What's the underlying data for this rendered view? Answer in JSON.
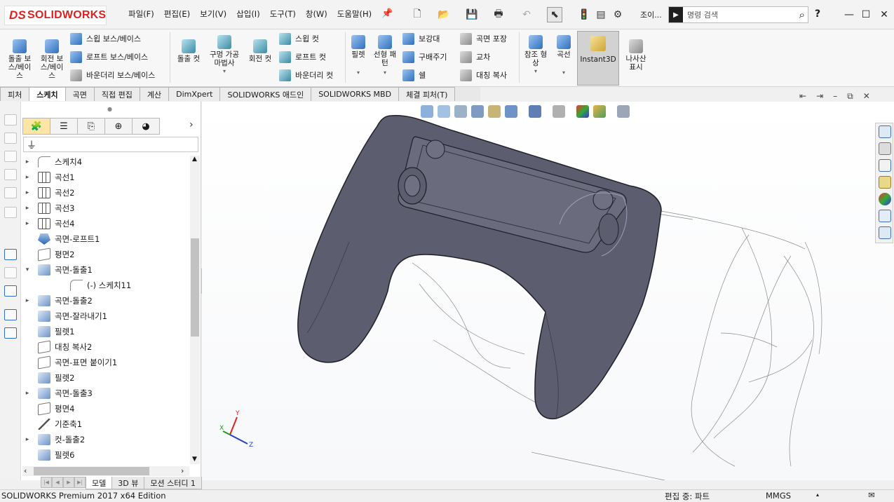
{
  "app": {
    "logo_text": "SOLIDWORKS",
    "menu": [
      "파일(F)",
      "편집(E)",
      "보기(V)",
      "삽입(I)",
      "도구(T)",
      "창(W)",
      "도움말(H)"
    ],
    "user_label": "조이...",
    "search_placeholder": "명령 검색",
    "help_label": "?"
  },
  "command_manager": {
    "large_buttons": [
      {
        "label": "돌출 보\n스/베이\n스",
        "icon": "extruded-boss-icon"
      },
      {
        "label": "회전 보\n스/베이\n스",
        "icon": "revolved-boss-icon"
      }
    ],
    "boss_group": [
      "스윕 보스/베이스",
      "로프트 보스/베이스",
      "바운더리 보스/베이스"
    ],
    "cut_large": [
      {
        "label": "돌출 컷",
        "icon": "extruded-cut-icon"
      },
      {
        "label": "구멍 가공\n마법사",
        "icon": "hole-wizard-icon"
      },
      {
        "label": "회전 컷",
        "icon": "revolved-cut-icon"
      }
    ],
    "cut_group": [
      "스윕 컷",
      "로프트 컷",
      "바운더리 컷"
    ],
    "feature_large": [
      {
        "label": "필렛",
        "icon": "fillet-icon"
      },
      {
        "label": "선형 패\n턴",
        "icon": "linear-pattern-icon"
      }
    ],
    "feature_group_a": [
      "보강대",
      "구배주기",
      "쉘"
    ],
    "feature_group_b": [
      "곡면 포장",
      "교차",
      "대칭 복사"
    ],
    "ref_large": [
      {
        "label": "참조 형\n상",
        "icon": "reference-geometry-icon"
      },
      {
        "label": "곡선",
        "icon": "curves-icon"
      }
    ],
    "instant3d_label": "Instant3D",
    "thread_label": "나사산\n표시"
  },
  "tabs": [
    {
      "label": "피처",
      "selected": false
    },
    {
      "label": "스케치",
      "selected": true
    },
    {
      "label": "곡면",
      "selected": false
    },
    {
      "label": "직접 편집",
      "selected": false
    },
    {
      "label": "계산",
      "selected": false
    },
    {
      "label": "DimXpert",
      "selected": false
    },
    {
      "label": "SOLIDWORKS 애드인",
      "selected": false
    },
    {
      "label": "SOLIDWORKS MBD",
      "selected": false
    },
    {
      "label": "체결 피처(T)",
      "selected": false
    }
  ],
  "tree": [
    {
      "label": "스케치4",
      "icon": "sketch",
      "expand": "▸",
      "indent": 0
    },
    {
      "label": "곡선1",
      "icon": "curve",
      "expand": "▸",
      "indent": 0
    },
    {
      "label": "곡선2",
      "icon": "curve",
      "expand": "▸",
      "indent": 0
    },
    {
      "label": "곡선3",
      "icon": "curve",
      "expand": "▸",
      "indent": 0
    },
    {
      "label": "곡선4",
      "icon": "curve",
      "expand": "▸",
      "indent": 0
    },
    {
      "label": "곡면-로프트1",
      "icon": "loft",
      "expand": "",
      "indent": 0
    },
    {
      "label": "평면2",
      "icon": "plane",
      "expand": "",
      "indent": 0
    },
    {
      "label": "곡면-돌출1",
      "icon": "surface",
      "expand": "▾",
      "indent": 0
    },
    {
      "label": "(-) 스케치11",
      "icon": "sketch",
      "expand": "",
      "indent": 1
    },
    {
      "label": "곡면-돌출2",
      "icon": "surface",
      "expand": "▸",
      "indent": 0
    },
    {
      "label": "곡면-잘라내기1",
      "icon": "surface",
      "expand": "",
      "indent": 0
    },
    {
      "label": "필렛1",
      "icon": "solid",
      "expand": "",
      "indent": 0
    },
    {
      "label": "대칭 복사2",
      "icon": "mirror",
      "expand": "",
      "indent": 0
    },
    {
      "label": "곡면-표면 붙이기1",
      "icon": "mirror",
      "expand": "",
      "indent": 0
    },
    {
      "label": "필렛2",
      "icon": "solid",
      "expand": "",
      "indent": 0
    },
    {
      "label": "곡면-돌출3",
      "icon": "surface",
      "expand": "▸",
      "indent": 0
    },
    {
      "label": "평면4",
      "icon": "plane",
      "expand": "",
      "indent": 0
    },
    {
      "label": "기준축1",
      "icon": "axis",
      "expand": "",
      "indent": 0
    },
    {
      "label": "컷-돌출2",
      "icon": "solid",
      "expand": "▸",
      "indent": 0
    },
    {
      "label": "필렛6",
      "icon": "solid",
      "expand": "",
      "indent": 0
    }
  ],
  "bottom_tabs": [
    {
      "label": "모델",
      "selected": true
    },
    {
      "label": "3D 뷰",
      "selected": false
    },
    {
      "label": "모션 스터디 1",
      "selected": false
    }
  ],
  "status": {
    "left": "SOLIDWORKS Premium 2017 x64 Edition",
    "editing": "편집 중: 파트",
    "units": "MMGS"
  },
  "triad": {
    "x": "X",
    "y": "Y",
    "z": "Z"
  },
  "colors": {
    "model_fill": "#5c5e70",
    "model_edge": "#1e1f28",
    "accent_red": "#d22222",
    "instant3d_bg": "#d2d2d2"
  }
}
